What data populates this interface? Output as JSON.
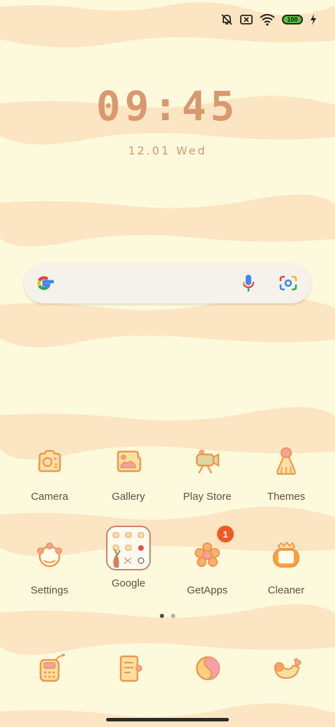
{
  "status_bar": {
    "icons": [
      "bell-muted-icon",
      "no-sim-icon",
      "wifi-icon",
      "battery-icon",
      "charging-icon"
    ],
    "battery_level": "100"
  },
  "clock": {
    "time": "09:45",
    "date": "12.01 Wed"
  },
  "search_bar": {
    "icons": [
      "google-logo-icon",
      "microphone-icon",
      "google-lens-icon"
    ]
  },
  "apps": [
    {
      "label": "Camera",
      "icon": "camera-icon"
    },
    {
      "label": "Gallery",
      "icon": "gallery-icon"
    },
    {
      "label": "Play Store",
      "icon": "play-store-icon"
    },
    {
      "label": "Themes",
      "icon": "themes-icon"
    },
    {
      "label": "Settings",
      "icon": "settings-icon"
    },
    {
      "label": "Google",
      "icon": "google-folder-icon"
    },
    {
      "label": "GetApps",
      "icon": "getapps-icon",
      "badge": "1"
    },
    {
      "label": "Cleaner",
      "icon": "cleaner-icon"
    }
  ],
  "page_indicator": {
    "pages": 2,
    "current": 1
  },
  "dock": [
    {
      "icon": "phone-icon"
    },
    {
      "icon": "messages-icon"
    },
    {
      "icon": "browser-icon"
    },
    {
      "icon": "chicken-app-icon"
    }
  ],
  "colors": {
    "background": "#fdf9dc",
    "stripe": "#fbe6c4",
    "accent": "#f0964a",
    "clock": "#d99870"
  }
}
